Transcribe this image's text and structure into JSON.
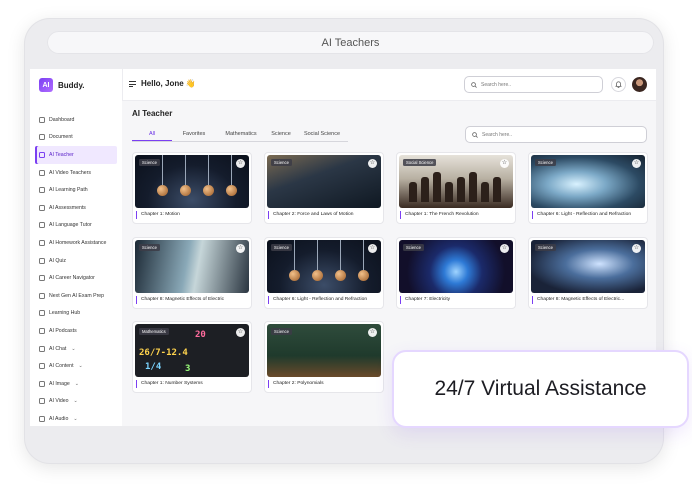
{
  "window": {
    "title": "AI Teachers"
  },
  "brand": {
    "logo_text": "AI",
    "name": "Buddy."
  },
  "sidebar": {
    "items": [
      {
        "label": "Dashboard",
        "active": false,
        "has_chevron": false
      },
      {
        "label": "Document",
        "active": false,
        "has_chevron": false
      },
      {
        "label": "AI Teacher",
        "active": true,
        "has_chevron": false
      },
      {
        "label": "AI Video Teachers",
        "active": false,
        "has_chevron": false
      },
      {
        "label": "AI Learning Path",
        "active": false,
        "has_chevron": false
      },
      {
        "label": "AI Assessments",
        "active": false,
        "has_chevron": false
      },
      {
        "label": "AI Language Tutor",
        "active": false,
        "has_chevron": false
      },
      {
        "label": "AI Homework Assistance",
        "active": false,
        "has_chevron": false
      },
      {
        "label": "AI Quiz",
        "active": false,
        "has_chevron": false
      },
      {
        "label": "AI Career Navigator",
        "active": false,
        "has_chevron": false
      },
      {
        "label": "Next Gen AI Exam Prep",
        "active": false,
        "has_chevron": false
      },
      {
        "label": "Learning Hub",
        "active": false,
        "has_chevron": false
      },
      {
        "label": "AI Podcasts",
        "active": false,
        "has_chevron": false
      },
      {
        "label": "AI Chat",
        "active": false,
        "has_chevron": true
      },
      {
        "label": "AI Content",
        "active": false,
        "has_chevron": true
      },
      {
        "label": "AI Image",
        "active": false,
        "has_chevron": true
      },
      {
        "label": "AI Video",
        "active": false,
        "has_chevron": true
      },
      {
        "label": "AI Audio",
        "active": false,
        "has_chevron": true
      }
    ]
  },
  "header": {
    "greeting": "Hello, Jone 👋",
    "search_placeholder": "Search here..",
    "icons": [
      "menu-icon",
      "bell-icon",
      "avatar"
    ]
  },
  "main": {
    "title": "AI Teacher",
    "tabs": [
      {
        "label": "All",
        "active": true
      },
      {
        "label": "Favorites",
        "active": false
      },
      {
        "label": "Mathematics",
        "active": false
      },
      {
        "label": "Science",
        "active": false
      },
      {
        "label": "Social Science",
        "active": false
      }
    ],
    "search_placeholder": "Search here..",
    "cards": [
      {
        "badge": "Science",
        "title": "Chapter 1: Motion",
        "thumb": "pendulum"
      },
      {
        "badge": "Science",
        "title": "Chapter 2: Force and Laws of Motion",
        "thumb": "force"
      },
      {
        "badge": "Social Science",
        "title": "Chapter 1: The French Revolution",
        "thumb": "revolution"
      },
      {
        "badge": "Science",
        "title": "Chapter 6: Light - Reflection and Refraction",
        "thumb": "light"
      },
      {
        "badge": "Science",
        "title": "Chapter 8: Magnetic Effects of Electric",
        "thumb": "magnetic"
      },
      {
        "badge": "Science",
        "title": "Chapter 6: Light - Reflection and Refraction",
        "thumb": "pendulum"
      },
      {
        "badge": "Science",
        "title": "Chapter 7: Electricity",
        "thumb": "electricity"
      },
      {
        "badge": "Science",
        "title": "Chapter 8: Magnetic Effects of Electric...",
        "thumb": "magnetic2"
      },
      {
        "badge": "Mathematics",
        "title": "Chapter 1: Number Systems",
        "thumb": "numbers"
      },
      {
        "badge": "Science",
        "title": "Chapter 2: Polynomials",
        "thumb": "polynomials"
      }
    ]
  },
  "overlay": {
    "text": "24/7 Virtual Assistance"
  },
  "colors": {
    "accent": "#7b3ff2",
    "active_bg": "#f0e8ff"
  }
}
